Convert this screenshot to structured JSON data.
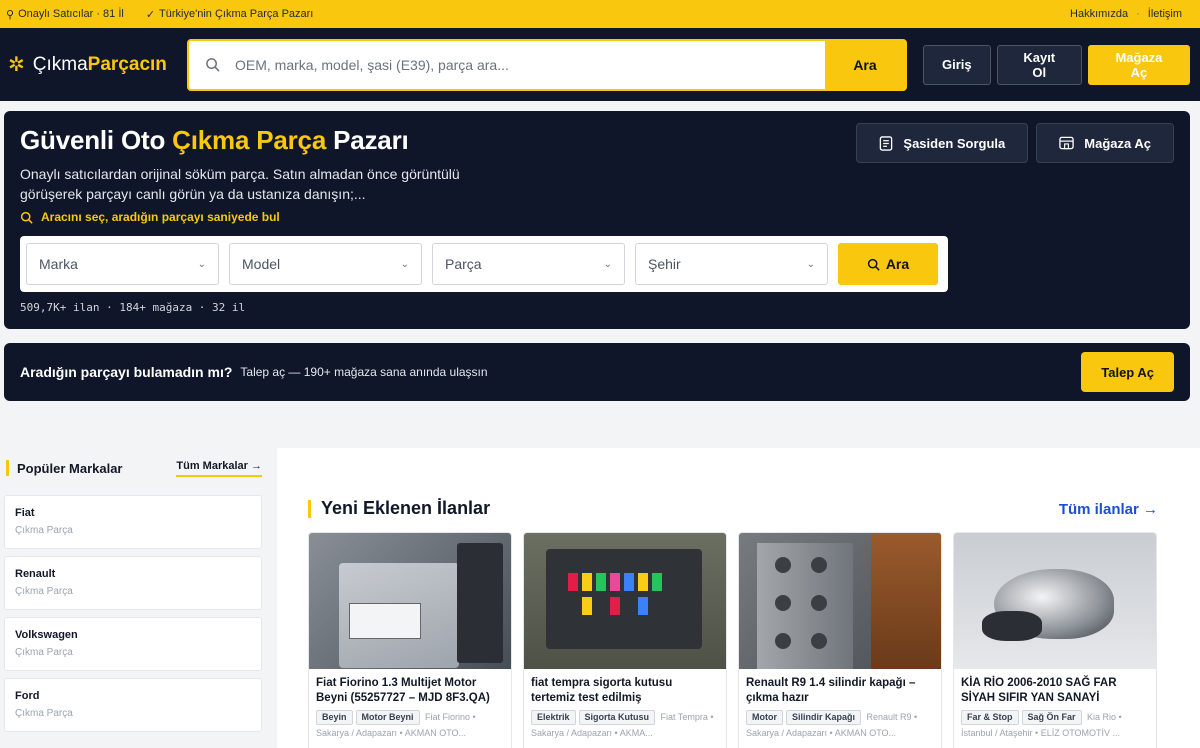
{
  "topbar": {
    "verified": "Onaylı Satıcılar · 81 İl",
    "tagline": "Türkiye'nin Çıkma Parça Pazarı",
    "about": "Hakkımızda",
    "sep": "·",
    "contact": "İletişim"
  },
  "header": {
    "logo_part1": "Çıkma",
    "logo_part2": "Parçacın",
    "search_placeholder": "OEM, marka, model, şasi (E39), parça ara...",
    "search_button": "Ara",
    "login": "Giriş",
    "register": "Kayıt Ol",
    "open_store": "Mağaza Aç"
  },
  "hero": {
    "title_pre": "Güvenli Oto ",
    "title_highlight": "Çıkma Parça",
    "title_post": " Pazarı",
    "description": "Onaylı satıcılardan orijinal söküm parça. Satın almadan önce görüntülü görüşerek parçayı canlı görün ya da ustanıza danışın;...",
    "tip": "Aracını seç, aradığın parçayı saniyede bul",
    "vin_query": "Şasiden Sorgula",
    "open_store": "Mağaza Aç",
    "filters": [
      "Marka",
      "Model",
      "Parça",
      "Şehir"
    ],
    "filter_button": "Ara",
    "stats": "509,7K+ ilan · 184+ mağaza · 32 il"
  },
  "request": {
    "question": "Aradığın parçayı bulamadın mı?",
    "subtitle": "Talep aç — 190+ mağaza sana anında ulaşsın",
    "button": "Talep Aç"
  },
  "sidebar": {
    "title": "Popüler Markalar",
    "all_link": "Tüm Markalar →",
    "brands": [
      {
        "name": "Fiat",
        "caption": "Çıkma Parça"
      },
      {
        "name": "Renault",
        "caption": "Çıkma Parça"
      },
      {
        "name": "Volkswagen",
        "caption": "Çıkma Parça"
      },
      {
        "name": "Ford",
        "caption": "Çıkma Parça"
      }
    ]
  },
  "listings": {
    "title": "Yeni Eklenen İlanlar",
    "all_link": "Tüm ilanlar →",
    "items": [
      {
        "title": "Fiat Fiorino 1.3 Multijet Motor Beyni (55257727 – MJD 8F3.QA)",
        "tags": [
          "Beyin",
          "Motor Beyni"
        ],
        "meta": "Fiat Fiorino • Sakarya / Adapazarı • AKMAN OTO..."
      },
      {
        "title": "fiat tempra sigorta kutusu tertemiz test edilmiş",
        "tags": [
          "Elektrik",
          "Sigorta Kutusu"
        ],
        "meta": "Fiat Tempra • Sakarya / Adapazarı • AKMA..."
      },
      {
        "title": "Renault R9 1.4 silindir kapağı – çıkma hazır",
        "tags": [
          "Motor",
          "Silindir Kapağı"
        ],
        "meta": "Renault R9 • Sakarya / Adapazarı • AKMAN OTO..."
      },
      {
        "title": "KİA RİO 2006-2010 SAĞ FAR SİYAH SIFIR YAN SANAYİ",
        "tags": [
          "Far & Stop",
          "Sağ Ön Far"
        ],
        "meta": "Kia Rio • İstanbul / Ataşehir • ELİZ OTOMOTİV ..."
      }
    ]
  },
  "colors": {
    "accent": "#f9c80e",
    "navy": "#0f1629",
    "link": "#1d4ed8"
  }
}
